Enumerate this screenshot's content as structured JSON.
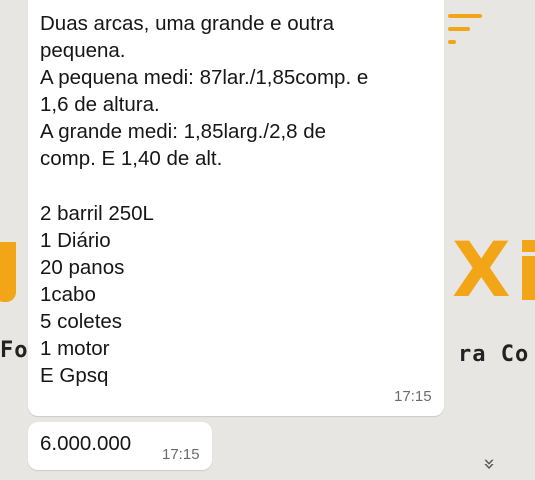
{
  "wallpaper": {
    "letters": {
      "left": "Fo",
      "right": "ra Co"
    }
  },
  "message": {
    "lines": [
      "Duas arcas, uma grande e outra",
      "pequena.",
      "A pequena medi: 87lar./1,85comp. e",
      "1,6 de altura.",
      "A grande medi: 1,85larg./2,8 de",
      "comp. E 1,40 de alt.",
      "",
      "2 barril 250L",
      "1 Diário",
      "20 panos",
      "1cabo",
      "5 coletes",
      "1 motor",
      "E Gpsq"
    ],
    "time": "17:15"
  },
  "price_message": {
    "text": "6.000.000",
    "time": "17:15"
  },
  "scroll_button": {
    "icon": "double-chevron-down-icon",
    "glyph": "»"
  }
}
